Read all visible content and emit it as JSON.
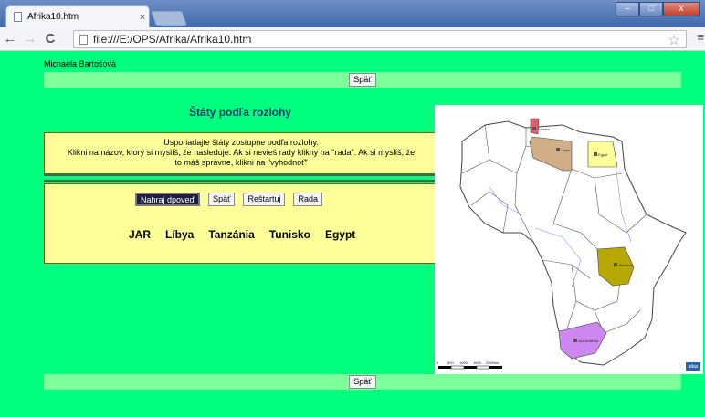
{
  "browser": {
    "tab_title": "Afrika10.htm",
    "tab_close": "×",
    "url": "file:///E:/OPS/Afrika/Afrika10.htm",
    "back": "←",
    "forward": "→",
    "reload": "C",
    "star": "☆",
    "menu": "≡",
    "win_min": "–",
    "win_max": "□",
    "win_close": "x"
  },
  "page": {
    "author": "Michaela Bartošová",
    "back_label": "Späť",
    "heading": "Štáty podľa rozlohy",
    "instructions": {
      "line1": "Usporiadajte štáty zostupne podľa rozlohy.",
      "line2": "Klikni na názov, ktorý si myslíš, že nasleduje. Ak si nevieš rady klikny na \"rada\". Ak si myslíš, že",
      "line3": "to máš správne, klikni na \"vyhodnoť\""
    },
    "buttons": {
      "load_answer": "Nahraj dpoveď",
      "back": "Späť",
      "restart": "Reštartuj",
      "hint": "Rada"
    },
    "words": [
      "JAR",
      "Líbya",
      "Tanzánia",
      "Tunisko",
      "Egypt"
    ]
  },
  "map": {
    "labels": {
      "tunisia": "Tunisko",
      "libya": "Líbya",
      "egypt": "Egypt",
      "tanzania": "Tanzánia",
      "south_africa": "Južná Afrika"
    },
    "scale_ticks": [
      "0",
      "500",
      "1000",
      "1500",
      "2000km"
    ],
    "logo": "atlas",
    "colors": {
      "tunisia": "#e0606a",
      "libya": "#d2ae86",
      "egypt": "#ffff99",
      "tanzania": "#b7a800",
      "south_africa": "#cc88ee"
    }
  }
}
